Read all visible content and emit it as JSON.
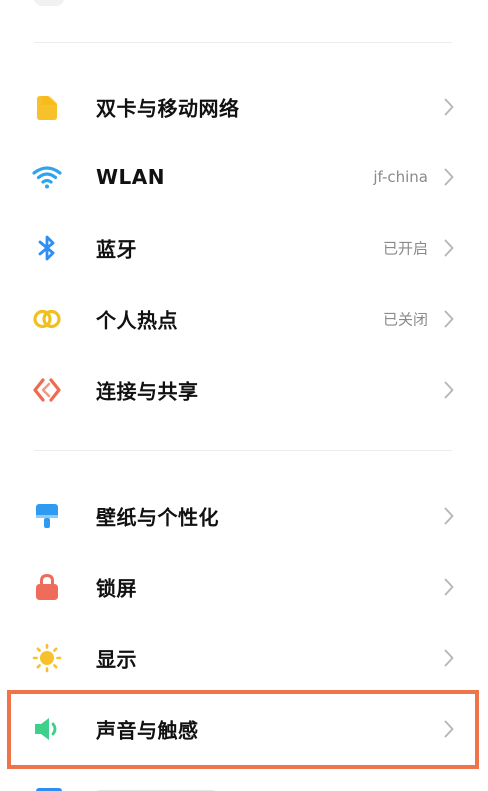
{
  "settings": {
    "items": [
      {
        "label": "双卡与移动网络",
        "value": "",
        "icon": "sim-card-icon",
        "icon_color": "#F7C12B"
      },
      {
        "label": "WLAN",
        "value": "jf-china",
        "icon": "wifi-icon",
        "icon_color": "#2FA4EE"
      },
      {
        "label": "蓝牙",
        "value": "已开启",
        "icon": "bluetooth-icon",
        "icon_color": "#2F8EF5"
      },
      {
        "label": "个人热点",
        "value": "已关闭",
        "icon": "hotspot-icon",
        "icon_color": "#F0C020"
      },
      {
        "label": "连接与共享",
        "value": "",
        "icon": "connection-share-icon",
        "icon_color": "#EE6A50"
      },
      {
        "label": "壁纸与个性化",
        "value": "",
        "icon": "wallpaper-icon",
        "icon_color": "#2F9BF0"
      },
      {
        "label": "锁屏",
        "value": "",
        "icon": "lock-icon",
        "icon_color": "#F06C5A"
      },
      {
        "label": "显示",
        "value": "",
        "icon": "brightness-icon",
        "icon_color": "#F7C12B"
      },
      {
        "label": "声音与触感",
        "value": "",
        "icon": "speaker-icon",
        "icon_color": "#3DD08A"
      }
    ]
  },
  "colors": {
    "highlight": "#F0744A",
    "text_primary": "#111111",
    "text_secondary": "#8A8A8A",
    "chevron": "#B5B5B5"
  }
}
